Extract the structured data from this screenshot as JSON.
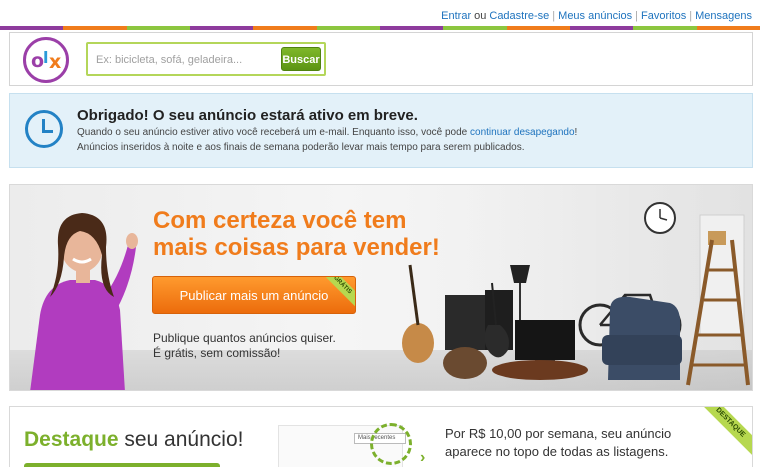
{
  "colors": {
    "stripe": [
      "#8e3b9d",
      "#f07c1c",
      "#8cc63f",
      "#8e3b9d",
      "#f07c1c",
      "#8cc63f",
      "#8e3b9d",
      "#8cc63f",
      "#f07c1c",
      "#8e3b9d",
      "#8cc63f",
      "#f07c1c"
    ],
    "accent_orange": "#f07c1c",
    "accent_green": "#7cb02c",
    "link_blue": "#1e73be",
    "info_bg": "#e3f1f9"
  },
  "toplinks": {
    "login": "Entrar",
    "or": "ou",
    "register": "Cadastre-se",
    "my_ads": "Meus anúncios",
    "favorites": "Favoritos",
    "messages": "Mensagens"
  },
  "header": {
    "logo_icon": "olx-logo",
    "search_placeholder": "Ex: bicicleta, sofá, geladeira...",
    "search_button": "Buscar"
  },
  "confirmation": {
    "icon": "clock-icon",
    "title": "Obrigado! O seu anúncio estará ativo em breve.",
    "line1_prefix": "Quando o seu anúncio estiver ativo você receberá um e-mail. Enquanto isso, você pode ",
    "line1_link": "continuar desapegando",
    "line1_suffix": "!",
    "line2": "Anúncios inseridos à noite e aos finais de semana poderão levar mais tempo para serem publicados."
  },
  "banner": {
    "headline_line1": "Com certeza você tem",
    "headline_line2": "mais coisas para vender!",
    "cta_label": "Publicar mais um anúncio",
    "cta_ribbon": "GRÁTIS",
    "sub_line1": "Publique quantos anúncios quiser.",
    "sub_line2": "É grátis, sem comissão!"
  },
  "promo": {
    "title_highlight": "Destaque",
    "title_rest": " seu anúncio!",
    "ribbon": "DESTAQUE",
    "mini_select": "Mais recentes",
    "price_line1": "Por R$ 10,00 por semana, seu anúncio",
    "price_line2": "aparece no topo de todas as listagens."
  }
}
